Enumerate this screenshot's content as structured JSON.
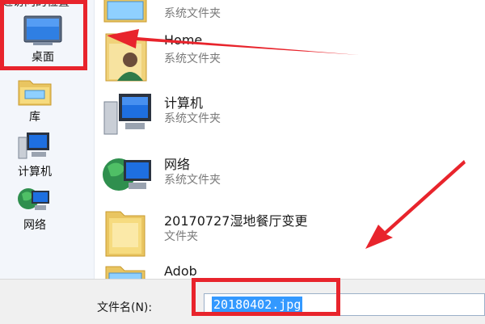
{
  "sidebar": {
    "header": "近访问的位置",
    "items": [
      {
        "label": "桌面",
        "icon": "desktop-icon"
      },
      {
        "label": "库",
        "icon": "library-folder-icon"
      },
      {
        "label": "计算机",
        "icon": "computer-icon"
      },
      {
        "label": "网络",
        "icon": "network-icon"
      }
    ]
  },
  "files": [
    {
      "name": "",
      "type": "系统文件夹",
      "icon": "folder-icon"
    },
    {
      "name": "Home",
      "type": "系统文件夹",
      "icon": "user-folder-icon"
    },
    {
      "name": "计算机",
      "type": "系统文件夹",
      "icon": "computer-icon"
    },
    {
      "name": "网络",
      "type": "系统文件夹",
      "icon": "network-icon"
    },
    {
      "name": "20170727湿地餐厅变更",
      "type": "文件夹",
      "icon": "folder-icon"
    },
    {
      "name": "Adob",
      "type": "",
      "icon": "folder-icon"
    }
  ],
  "filename": {
    "label": "文件名(N):",
    "value": "20180402.jpg"
  },
  "annotations": {
    "color": "#e8242c"
  }
}
